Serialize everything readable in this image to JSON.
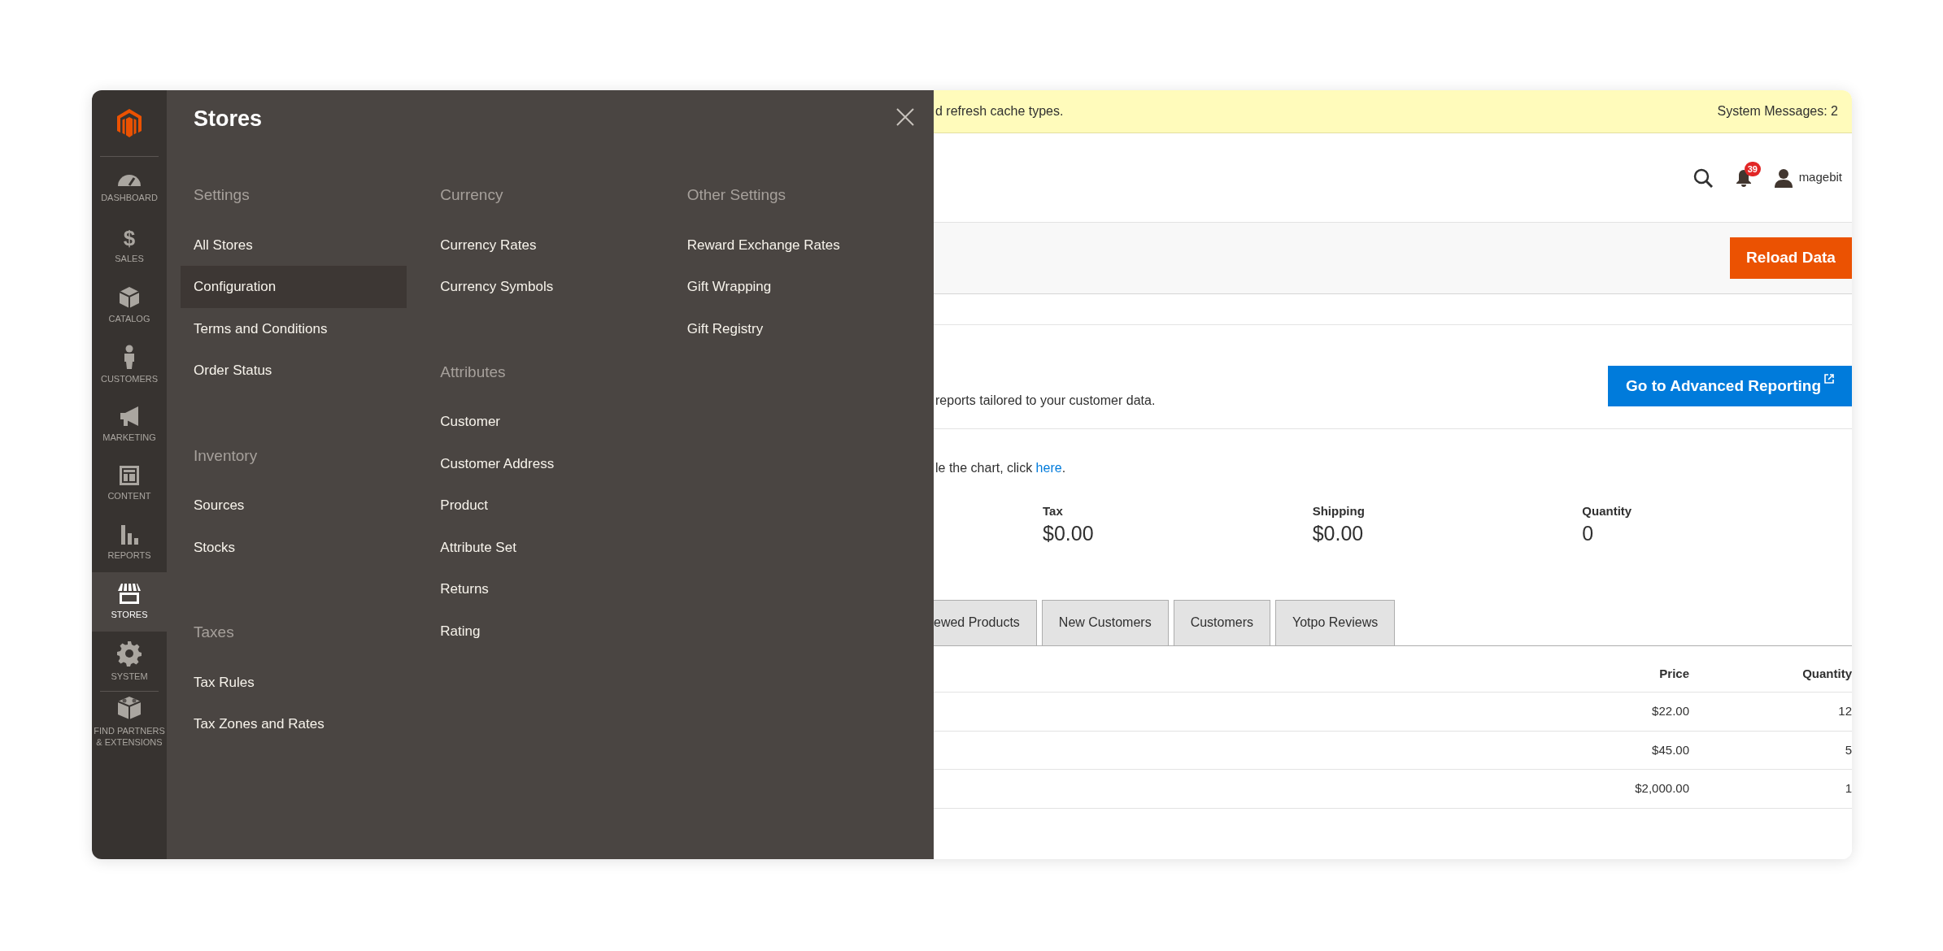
{
  "sidebar": {
    "items": [
      {
        "label": "DASHBOARD",
        "selected": false
      },
      {
        "label": "SALES",
        "glyph": "$",
        "selected": false
      },
      {
        "label": "CATALOG",
        "selected": false
      },
      {
        "label": "CUSTOMERS",
        "selected": false
      },
      {
        "label": "MARKETING",
        "selected": false
      },
      {
        "label": "CONTENT",
        "selected": false
      },
      {
        "label": "REPORTS",
        "selected": false
      },
      {
        "label": "STORES",
        "selected": true
      },
      {
        "label": "SYSTEM",
        "selected": false
      },
      {
        "label": "FIND PARTNERS & EXTENSIONS",
        "selected": false
      }
    ]
  },
  "menu": {
    "title": "Stores",
    "columns": [
      {
        "groups": [
          {
            "heading": "Settings",
            "items": [
              {
                "label": "All Stores",
                "selected": false
              },
              {
                "label": "Configuration",
                "selected": true
              },
              {
                "label": "Terms and Conditions",
                "selected": false
              },
              {
                "label": "Order Status",
                "selected": false
              }
            ]
          },
          {
            "heading": "Inventory",
            "items": [
              {
                "label": "Sources",
                "selected": false
              },
              {
                "label": "Stocks",
                "selected": false
              }
            ]
          },
          {
            "heading": "Taxes",
            "items": [
              {
                "label": "Tax Rules",
                "selected": false
              },
              {
                "label": "Tax Zones and Rates",
                "selected": false
              }
            ]
          }
        ]
      },
      {
        "groups": [
          {
            "heading": "Currency",
            "items": [
              {
                "label": "Currency Rates",
                "selected": false
              },
              {
                "label": "Currency Symbols",
                "selected": false
              }
            ]
          },
          {
            "heading": "Attributes",
            "items": [
              {
                "label": "Customer",
                "selected": false
              },
              {
                "label": "Customer Address",
                "selected": false
              },
              {
                "label": "Product",
                "selected": false
              },
              {
                "label": "Attribute Set",
                "selected": false
              },
              {
                "label": "Returns",
                "selected": false
              },
              {
                "label": "Rating",
                "selected": false
              }
            ]
          }
        ]
      },
      {
        "groups": [
          {
            "heading": "Other Settings",
            "items": [
              {
                "label": "Reward Exchange Rates",
                "selected": false
              },
              {
                "label": "Gift Wrapping",
                "selected": false
              },
              {
                "label": "Gift Registry",
                "selected": false
              }
            ]
          }
        ]
      }
    ]
  },
  "system_message": {
    "text": "d refresh cache types.",
    "count": "System Messages: 2"
  },
  "header": {
    "notifications": "39",
    "user": "magebit"
  },
  "reload_button": "Reload Data",
  "reporting": {
    "text": "reports tailored to your customer data.",
    "button": "Go to Advanced Reporting"
  },
  "chart_note": {
    "text": "le the chart, click ",
    "link": "here",
    "after": "."
  },
  "totals": [
    {
      "label": "Tax",
      "value": "$0.00"
    },
    {
      "label": "Shipping",
      "value": "$0.00"
    },
    {
      "label": "Quantity",
      "value": "0"
    }
  ],
  "tabs": [
    {
      "label": "ewed Products",
      "selected": false
    },
    {
      "label": "New Customers",
      "selected": false
    },
    {
      "label": "Customers",
      "selected": false
    },
    {
      "label": "Yotpo Reviews",
      "selected": false
    }
  ],
  "table": {
    "columns": [
      "Price",
      "Quantity"
    ],
    "rows": [
      [
        "$22.00",
        "12"
      ],
      [
        "$45.00",
        "5"
      ],
      [
        "$2,000.00",
        "1"
      ]
    ]
  }
}
